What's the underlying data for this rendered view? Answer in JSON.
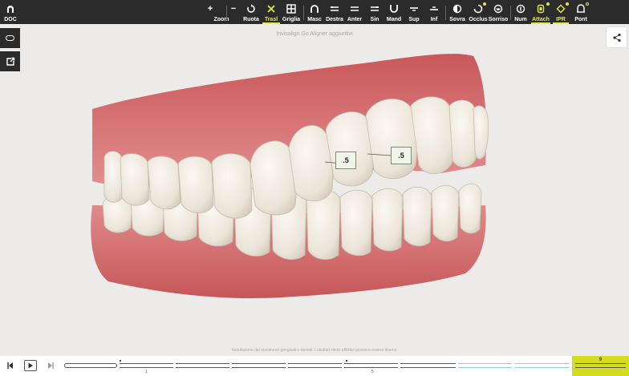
{
  "toolbar": {
    "doc_label": "DOC",
    "buttons": [
      {
        "label": "Zoom",
        "icon": "zoom-icon"
      },
      {
        "label": "Ruota",
        "icon": "rotate-icon"
      },
      {
        "label": "Trasl",
        "icon": "move-icon",
        "active": true
      },
      {
        "label": "Griglia",
        "icon": "grid-icon"
      },
      {
        "label": "Masc",
        "icon": "upper-arch-icon"
      },
      {
        "label": "Destra",
        "icon": "right-view-icon"
      },
      {
        "label": "Anter",
        "icon": "front-view-icon"
      },
      {
        "label": "Sin",
        "icon": "left-view-icon"
      },
      {
        "label": "Mand",
        "icon": "lower-arch-icon"
      },
      {
        "label": "Sup",
        "icon": "top-view-icon"
      },
      {
        "label": "Inf",
        "icon": "bottom-view-icon"
      },
      {
        "label": "Sovra",
        "icon": "overlay-icon"
      },
      {
        "label": "Occlus",
        "icon": "occlusion-icon"
      },
      {
        "label": "Sorriso",
        "icon": "smile-icon"
      },
      {
        "label": "Num",
        "icon": "number-icon"
      },
      {
        "label": "Attach",
        "icon": "attachment-icon",
        "active": true
      },
      {
        "label": "IPR",
        "icon": "ipr-icon",
        "active": true
      },
      {
        "label": "Pont",
        "icon": "pontic-icon"
      }
    ],
    "zoom_plus": "+",
    "zoom_minus": "−"
  },
  "view": {
    "title": "Invisalign Go Aligner aggiuntivi",
    "ipr_labels": [
      ".5",
      ".5"
    ],
    "disclaimer": "Simulazione dei movimenti gengivali e dentali. I risultati clinici effettivi possono essere diversi."
  },
  "timeline": {
    "stage_numbers": [
      "1",
      "5"
    ],
    "current_stage": "9"
  },
  "colors": {
    "toolbar_bg": "#2b2b2b",
    "accent": "#e3e84a",
    "timeline_current": "#d4dc1d",
    "overcorrection": "#8fd0de",
    "gum": "#d8787a",
    "tooth": "#efe9df"
  }
}
